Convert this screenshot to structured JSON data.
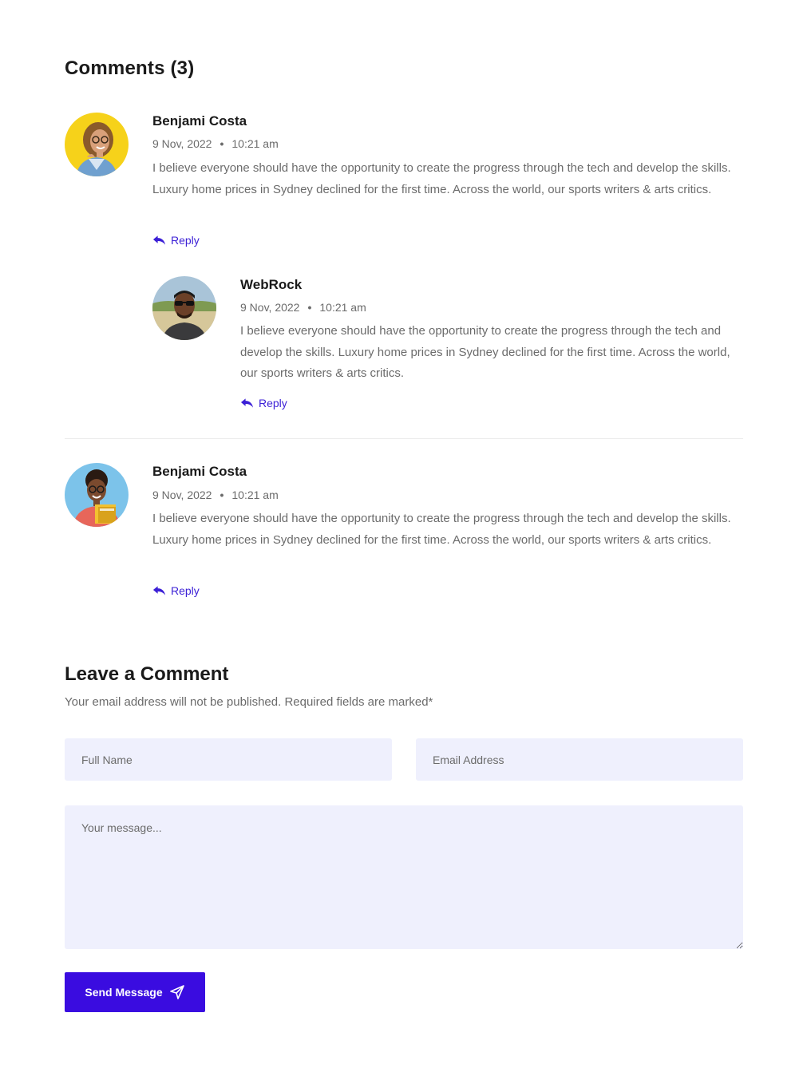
{
  "comments_section": {
    "title": "Comments (3)"
  },
  "comments": [
    {
      "author": "Benjami Costa",
      "date": "9 Nov, 2022",
      "separator": "•",
      "time": "10:21 am",
      "text": "I believe everyone should have the opportunity to create the progress through the tech and develop the skills. Luxury home prices in Sydney declined for the first time. Across the world, our sports writers & arts critics.",
      "reply_label": "Reply",
      "avatar_icon": "woman-with-glasses-avatar"
    },
    {
      "author": "WebRock",
      "date": "9 Nov, 2022",
      "separator": "•",
      "time": "10:21 am",
      "text": "I believe everyone should have the opportunity to create the progress through the tech and develop the skills. Luxury home prices in Sydney declined for the first time. Across the world, our sports writers & arts critics.",
      "reply_label": "Reply",
      "avatar_icon": "man-with-sunglasses-avatar"
    },
    {
      "author": "Benjami Costa",
      "date": "9 Nov, 2022",
      "separator": "•",
      "time": "10:21 am",
      "text": "I believe everyone should have the opportunity to create the progress through the tech and develop the skills. Luxury home prices in Sydney declined for the first time. Across the world, our sports writers & arts critics.",
      "reply_label": "Reply",
      "avatar_icon": "woman-with-books-avatar"
    }
  ],
  "form": {
    "title": "Leave a Comment",
    "subtitle": "Your email address will not be published. Required fields are marked*",
    "full_name_placeholder": "Full Name",
    "full_name_value": "",
    "email_placeholder": "Email Address",
    "email_value": "",
    "message_placeholder": "Your message...",
    "message_value": "",
    "submit_label": "Send Message"
  },
  "colors": {
    "accent": "#3a0ce0",
    "link": "#3b1fd6",
    "field_bg": "#eff0fd",
    "body_text": "#6b6b6b",
    "heading": "#1a1a1a"
  },
  "icons": {
    "reply": "reply-icon",
    "send": "paper-plane-icon"
  }
}
